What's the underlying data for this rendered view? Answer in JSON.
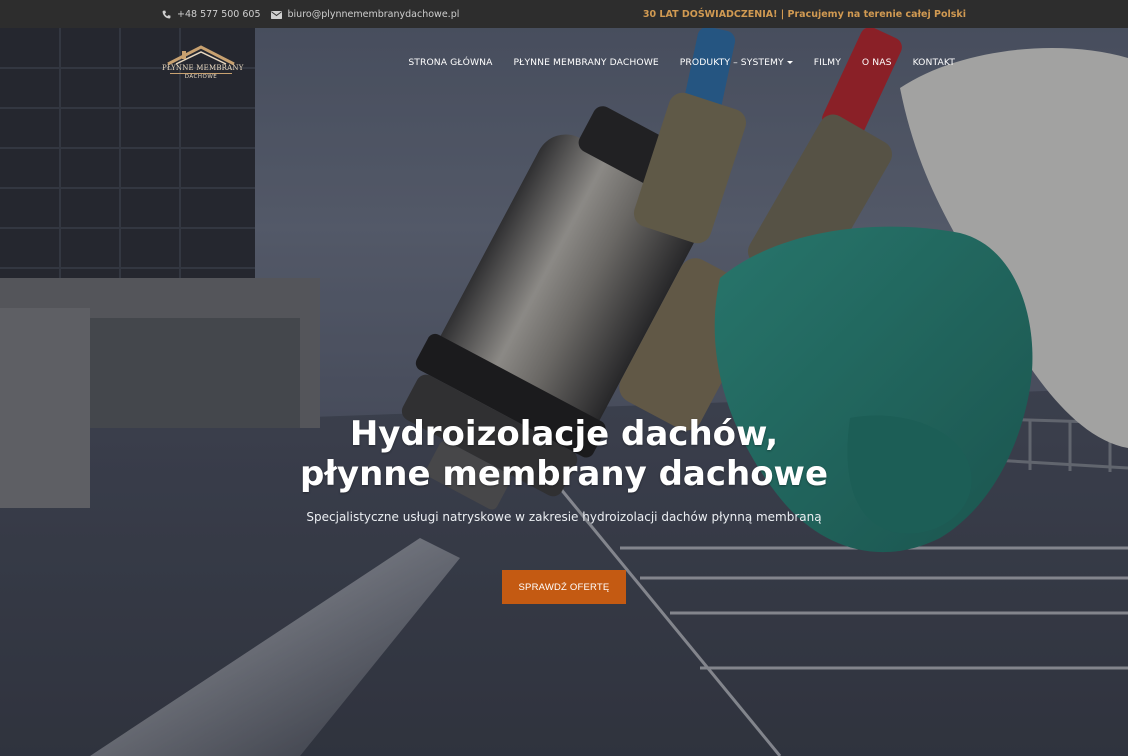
{
  "topbar": {
    "phone": "+48 577 500 605",
    "email": "biuro@plynnemembranydachowe.pl",
    "tagline": "30 LAT DOŚWIADCZENIA! | Pracujemy na terenie całej Polski"
  },
  "logo": {
    "name": "PŁYNNE MEMBRANY",
    "sub": "DACHOWE"
  },
  "nav": {
    "items": [
      "STRONA GŁÓWNA",
      "PŁYNNE MEMBRANY DACHOWE",
      "PRODUKTY – SYSTEMY",
      "FILMY",
      "O NAS",
      "KONTAKT"
    ]
  },
  "hero": {
    "title_line1": "Hydroizolacje dachów,",
    "title_line2": "płynne membrany dachowe",
    "subtitle": "Specjalistyczne usługi natryskowe w zakresie hydroizolacji dachów płynną membraną",
    "cta_label": "SPRAWDŹ OFERTĘ"
  },
  "colors": {
    "topbar_bg": "#2d2d2d",
    "accent": "#d19a52",
    "cta": "#c45a12"
  }
}
